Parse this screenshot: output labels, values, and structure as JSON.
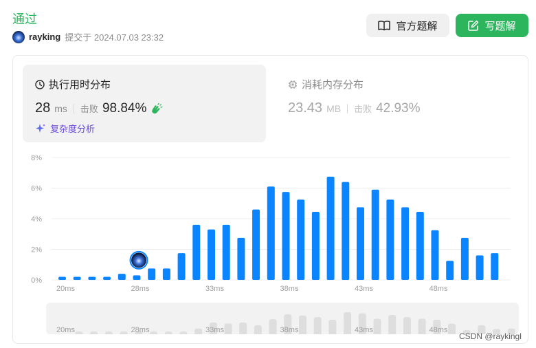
{
  "header": {
    "status": "通过",
    "username": "rayking",
    "submitted_text": "提交于 2024.07.03 23:32",
    "solution_button": "官方题解",
    "write_button": "写题解"
  },
  "runtime": {
    "title": "执行用时分布",
    "value": "28",
    "unit": "ms",
    "beat_label": "击败",
    "beat_pct": "98.84%",
    "analysis_label": "复杂度分析"
  },
  "memory": {
    "title": "消耗内存分布",
    "value": "23.43",
    "unit": "MB",
    "beat_label": "击败",
    "beat_pct": "42.93%"
  },
  "colors": {
    "accent_green": "#2db55d",
    "bar_blue": "#0a84ff",
    "mini_bar": "#dedede"
  },
  "chart_data": {
    "type": "bar",
    "x_start_ms": 20,
    "xticks": [
      "20ms",
      "28ms",
      "33ms",
      "38ms",
      "43ms",
      "48ms"
    ],
    "yticks": [
      "8%",
      "6%",
      "4%",
      "2%",
      "0%"
    ],
    "ylim": [
      0,
      8
    ],
    "values": [
      0.2,
      0.2,
      0.2,
      0.2,
      0.4,
      0.3,
      0.75,
      0.75,
      1.75,
      3.6,
      3.3,
      3.6,
      2.75,
      4.6,
      6.1,
      5.75,
      5.25,
      4.45,
      6.75,
      6.4,
      4.75,
      5.9,
      5.25,
      4.75,
      4.45,
      3.25,
      1.25,
      2.75,
      1.6,
      1.75
    ],
    "highlight_ms": 28,
    "grid": true
  },
  "watermark": "CSDN @raykingl"
}
